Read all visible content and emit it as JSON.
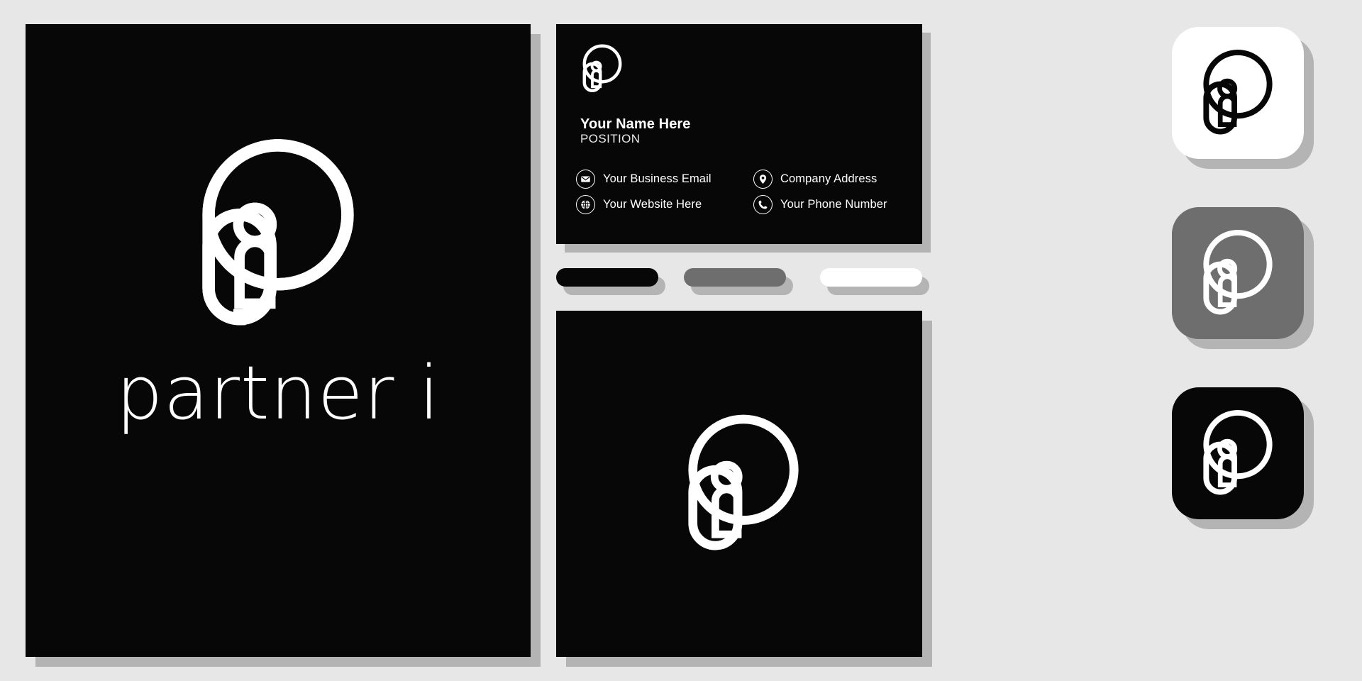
{
  "brand": {
    "name": "partner i",
    "logo_icon": "partner-p-person-logo",
    "colors": {
      "background": "#e7e7e7",
      "dark": "#070707",
      "gray": "#6e6e6e",
      "light": "#ffffff",
      "shadow": "#b4b4b4"
    }
  },
  "hero": {
    "wordmark": "partner i"
  },
  "business_card": {
    "name": "Your Name Here",
    "position": "POSITION",
    "contacts": [
      {
        "icon": "envelope-icon",
        "label": "Your Business Email"
      },
      {
        "icon": "location-pin-icon",
        "label": "Company Address"
      },
      {
        "icon": "globe-icon",
        "label": "Your Website Here"
      },
      {
        "icon": "phone-icon",
        "label": "Your Phone Number"
      }
    ]
  },
  "swatches": [
    {
      "name": "black",
      "color": "#070707"
    },
    {
      "name": "gray",
      "color": "#6e6e6e"
    },
    {
      "name": "white",
      "color": "#ffffff"
    }
  ],
  "app_icons": [
    {
      "name": "light-tile",
      "background": "#ffffff",
      "mark_color": "#070707"
    },
    {
      "name": "gray-tile",
      "background": "#6e6e6e",
      "mark_color": "#ffffff"
    },
    {
      "name": "dark-tile",
      "background": "#070707",
      "mark_color": "#ffffff"
    }
  ]
}
